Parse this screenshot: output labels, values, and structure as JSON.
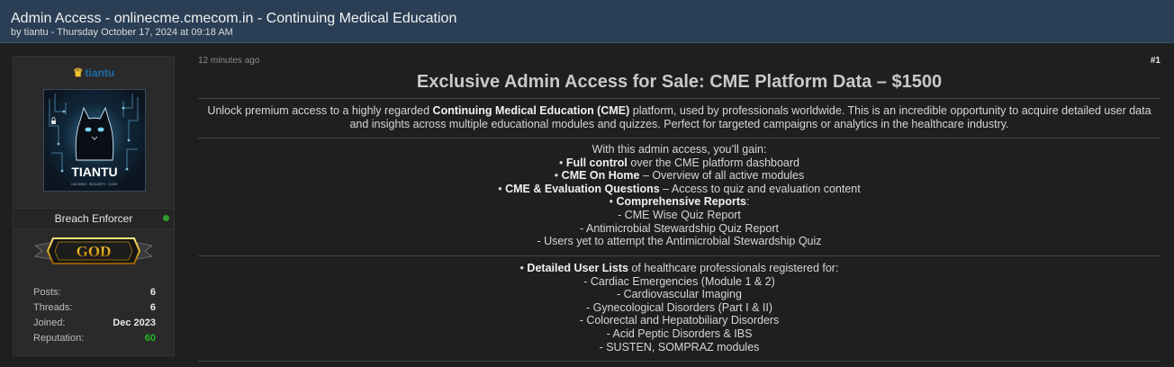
{
  "thread": {
    "title": "Admin Access - onlinecme.cmecom.in - Continuing Medical Education",
    "meta": "by tiantu - Thursday October 17, 2024 at 09:18 AM"
  },
  "user": {
    "username": "tiantu",
    "crown_icon": "crown-icon",
    "avatar_text": "TIANTU",
    "avatar_subtext": "HACKING · SECURITY · CODE",
    "role": "Breach Enforcer",
    "online_color": "#2e9b2e",
    "rank_badge": "GOD",
    "stats": [
      {
        "label": "Posts:",
        "value": "6"
      },
      {
        "label": "Threads:",
        "value": "6"
      },
      {
        "label": "Joined:",
        "value": "Dec 2023"
      },
      {
        "label": "Reputation:",
        "value": "60"
      }
    ]
  },
  "post": {
    "time": "12 minutes ago",
    "number": "#1",
    "heading": "Exclusive Admin Access for Sale: CME Platform Data – $1500",
    "intro": {
      "pre": "Unlock premium access to a highly regarded ",
      "bold": "Continuing Medical Education (CME)",
      "line1_post": " platform, used by professionals worldwide. This is an incredible opportunity to acquire detailed user data",
      "line2": "and insights across multiple educational modules and quizzes. Perfect for targeted campaigns or analytics in the healthcare industry."
    },
    "features": {
      "lead": "With this admin access, you’ll gain:",
      "items": [
        {
          "bold": "Full control",
          "rest": " over the CME platform dashboard"
        },
        {
          "bold": "CME On Home",
          "rest": " – Overview of all active modules"
        },
        {
          "bold": "CME & Evaluation Questions",
          "rest": " – Access to quiz and evaluation content"
        },
        {
          "bold": "Comprehensive Reports",
          "rest": ":"
        }
      ],
      "sub_items": [
        "- CME Wise Quiz Report",
        "- Antimicrobial Stewardship Quiz Report",
        "- Users yet to attempt the Antimicrobial Stewardship Quiz"
      ]
    },
    "user_lists": {
      "bold": "Detailed User Lists",
      "rest": " of healthcare professionals registered for:",
      "items": [
        "- Cardiac Emergencies (Module 1 & 2)",
        "- Cardiovascular Imaging",
        "- Gynecological Disorders (Part I & II)",
        "- Colorectal and Hepatobiliary Disorders",
        "- Acid Peptic Disorders & IBS",
        "- SUSTEN, SOMPRAZ modules"
      ]
    },
    "bullet": "•"
  }
}
